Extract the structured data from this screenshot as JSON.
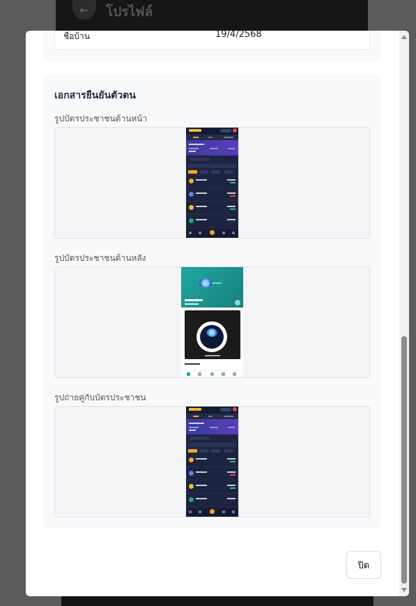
{
  "background": {
    "page_title": "โปรไฟล์",
    "back_icon": "arrow-left-icon"
  },
  "profile": {
    "field_label": "ชื่อบ้าน",
    "field_value": "19/4/2568"
  },
  "documents": {
    "section_title": "เอกสารยืนยันตัวตน",
    "items": [
      {
        "label": "รูปบัตรประชาชนด้านหน้า"
      },
      {
        "label": "รูปบัตรประชาชนด้านหลัง"
      },
      {
        "label": "รูปถ่ายคู่กับบัตรประชาชน"
      }
    ]
  },
  "footer": {
    "close_label": "ปิด"
  },
  "colors": {
    "accent": "#f5a623",
    "app_dark": "#1c2440",
    "teal": "#1fa7a0"
  }
}
